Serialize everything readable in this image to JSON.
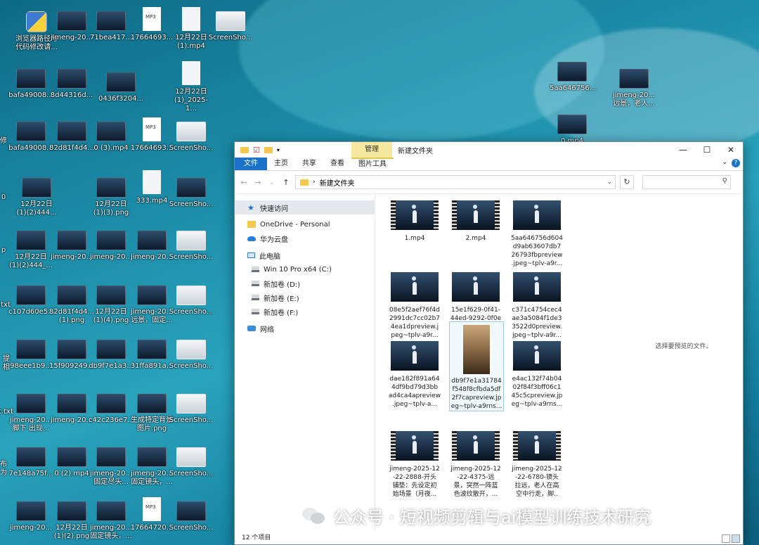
{
  "desktop": {
    "icons": [
      {
        "label": "浏览器路径与\n代码修改请...",
        "kind": "py"
      },
      {
        "label": "jimeng-20...",
        "kind": "img"
      },
      {
        "label": "71bea417...",
        "kind": "img"
      },
      {
        "label": "17664693...",
        "kind": "mp3"
      },
      {
        "label": "12月22日\n(1).mp4",
        "kind": "doc"
      },
      {
        "label": "ScreenSho...",
        "kind": "shot"
      },
      {
        "label": "bafa49008...",
        "kind": "img"
      },
      {
        "label": "8d44316d...",
        "kind": "img"
      },
      {
        "label": "0436f3204...",
        "kind": "img"
      },
      {
        "label": "12月22日\n(1)_2025-1...",
        "kind": "doc"
      },
      {
        "label": "bafa49008...",
        "kind": "img"
      },
      {
        "label": "82d81f4d4...",
        "kind": "img"
      },
      {
        "label": "0 (3).mp4",
        "kind": "img"
      },
      {
        "label": "17664693...",
        "kind": "mp3"
      },
      {
        "label": "ScreenSho...",
        "kind": "shot"
      },
      {
        "label": "12月22日\n(1)(2)444...",
        "kind": "img"
      },
      {
        "label": "12月22日\n(1)(3).png",
        "kind": "img"
      },
      {
        "label": "333.mp4",
        "kind": "doc"
      },
      {
        "label": "ScreenSho...",
        "kind": "img"
      },
      {
        "label": "12月22日\n(1)(2)444_...",
        "kind": "img"
      },
      {
        "label": "jimeng-20...",
        "kind": "img"
      },
      {
        "label": "jimeng-20...",
        "kind": "img"
      },
      {
        "label": "jimeng-20...",
        "kind": "img"
      },
      {
        "label": "ScreenSho...",
        "kind": "shot"
      },
      {
        "label": "c107d60e5...",
        "kind": "img"
      },
      {
        "label": "82d81f4d4...\n(1).png",
        "kind": "img"
      },
      {
        "label": "12月22日\n(1)(4).png",
        "kind": "img"
      },
      {
        "label": "jimeng-20...\n远景，固定...",
        "kind": "img"
      },
      {
        "label": "ScreenSho...",
        "kind": "shot"
      },
      {
        "label": "98eee1b9...",
        "kind": "img"
      },
      {
        "label": "15f909249...",
        "kind": "img"
      },
      {
        "label": "db9f7e1a3...",
        "kind": "img"
      },
      {
        "label": "31ffa891a...",
        "kind": "img"
      },
      {
        "label": "ScreenSho...",
        "kind": "shot"
      },
      {
        "label": "jimeng-20...\n脚下 出现...",
        "kind": "img"
      },
      {
        "label": "jimeng-20...",
        "kind": "img"
      },
      {
        "label": "c42c236e7...",
        "kind": "img"
      },
      {
        "label": "生成特定背景\n图片.png",
        "kind": "img"
      },
      {
        "label": "ScreenSho...",
        "kind": "shot"
      },
      {
        "label": "7e148a75f...",
        "kind": "img"
      },
      {
        "label": "0 (2).mp4",
        "kind": "img"
      },
      {
        "label": "jimeng-20...\n固定尽头...",
        "kind": "img"
      },
      {
        "label": "jimeng-20...\n固定镜头，...",
        "kind": "img"
      },
      {
        "label": "ScreenSho...",
        "kind": "shot"
      },
      {
        "label": "jimeng-20...",
        "kind": "img"
      },
      {
        "label": "12月22日\n(1)(2).png",
        "kind": "img"
      },
      {
        "label": "jimeng-20...\n固定镜头，...",
        "kind": "img"
      },
      {
        "label": "17664720...",
        "kind": "mp3"
      },
      {
        "label": "ScreenSho...",
        "kind": "img"
      },
      {
        "label": "5aa646756...",
        "kind": "img"
      },
      {
        "label": "jimeng-20...\n远景，老人...",
        "kind": "img"
      },
      {
        "label": "0.mp4",
        "kind": "img"
      }
    ],
    "edge_labels": [
      "修",
      "0",
      "p",
      ".txt",
      "提\n相",
      "t.txt",
      "布\n为"
    ]
  },
  "explorer": {
    "title": "新建文件夹",
    "manage_tab": "管理",
    "tabs": [
      "文件",
      "主页",
      "共享",
      "查看",
      "图片工具"
    ],
    "address": "新建文件夹",
    "nav": [
      {
        "label": "快速访问",
        "icon": "star-icon"
      },
      {
        "label": "OneDrive - Personal",
        "icon": "folder-icon"
      },
      {
        "label": "华为云盘",
        "icon": "cloud-icon"
      },
      {
        "label": "此电脑",
        "icon": "computer-icon"
      },
      {
        "label": "Win 10 Pro x64 (C:)",
        "icon": "drive-icon"
      },
      {
        "label": "新加卷 (D:)",
        "icon": "drive-icon"
      },
      {
        "label": "新加卷 (E:)",
        "icon": "drive-icon"
      },
      {
        "label": "新加卷 (F:)",
        "icon": "drive-icon"
      },
      {
        "label": "网络",
        "icon": "network-icon"
      }
    ],
    "files": [
      {
        "name": "1.mp4",
        "film": true
      },
      {
        "name": "2.mp4",
        "film": true
      },
      {
        "name": "5aa646756d604\nd9ab63607db7\n26793fbpreview\n.jpeg~tplv-a9r...",
        "film": false
      },
      {
        "name": "08e5f2aef76f4d\n2991dc7cc02b7\n4ea1dpreview.j\npeg~tplv-a9r...",
        "film": false
      },
      {
        "name": "15e1f629-0f41-\n44ed-9292-0f0e\nd09b63fa.jpg",
        "film": false
      },
      {
        "name": "c371c4754cec4\nae3a5084f1de3\n3522d0preview.\njpeg~tplv-a9r...",
        "film": false
      },
      {
        "name": "dae182f891a64\n4df9bd79d3bb\nad4ca4apreview\n.jpeg~tplv-a...",
        "film": false
      },
      {
        "name": "db9f7e1a31784\nf548f8cfbda5df\n2f7capreview.jp\neg~tplv-a9rns...",
        "film": false,
        "portrait": true
      },
      {
        "name": "e4ac132f74b04\n02f84f3bff06c1\n45c5cpreview.jp\neg~tplv-a9rns...",
        "film": false
      },
      {
        "name": "jimeng-2025-12\n-22-2888-开头\n铺垫：先设定初\n始场景（月夜...",
        "film": true
      },
      {
        "name": "jimeng-2025-12\n-22-4375-远\n景，突然一阵蓝\n色波纹散开，...",
        "film": true
      },
      {
        "name": "jimeng-2025-12\n-22-6780-镜头\n拉远，老人在高\n空中行走，脚..",
        "film": true
      }
    ],
    "preview_hint": "选择要预览的文件。",
    "status": "12 个项目"
  },
  "watermark": {
    "text": "公众号 · 短视频剪辑与ai模型训练技术研究"
  }
}
